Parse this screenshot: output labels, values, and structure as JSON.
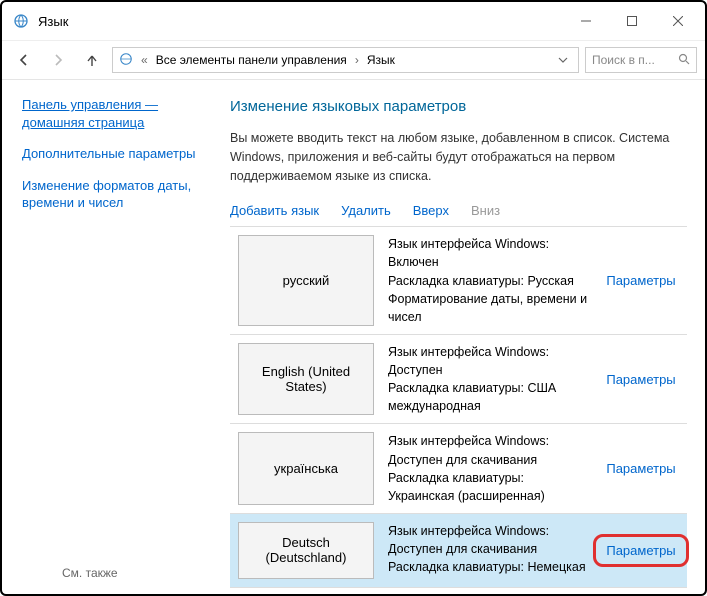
{
  "titlebar": {
    "title": "Язык"
  },
  "breadcrumb": {
    "root": "Все элементы панели управления",
    "leaf": "Язык"
  },
  "search": {
    "placeholder": "Поиск в п..."
  },
  "sidebar": {
    "home": "Панель управления — домашняя страница",
    "advanced": "Дополнительные параметры",
    "datetime": "Изменение форматов даты, времени и чисел",
    "seealso": "См. также"
  },
  "main": {
    "heading": "Изменение языковых параметров",
    "description": "Вы можете вводить текст на любом языке, добавленном в список. Система Windows, приложения и веб-сайты будут отображаться на первом поддерживаемом языке из списка."
  },
  "toolbar": {
    "add": "Добавить язык",
    "remove": "Удалить",
    "up": "Вверх",
    "down": "Вниз"
  },
  "labels": {
    "winlang": "Язык интерфейса Windows:",
    "layout": "Раскладка клавиатуры:",
    "format": "Форматирование даты, времени и чисел",
    "params": "Параметры"
  },
  "languages": [
    {
      "name": "русский",
      "winlang_status": "Включен",
      "layout_value": "Русская",
      "show_format": true
    },
    {
      "name": "English (United States)",
      "winlang_status": "Доступен",
      "layout_value": "США международная",
      "show_format": false
    },
    {
      "name": "українська",
      "winlang_status": "Доступен для скачивания",
      "layout_value": "Украинская (расширенная)",
      "show_format": false
    },
    {
      "name": "Deutsch (Deutschland)",
      "winlang_status": "Доступен для скачивания",
      "layout_value": "Немецкая",
      "show_format": false,
      "selected": true,
      "highlighted": true
    }
  ]
}
